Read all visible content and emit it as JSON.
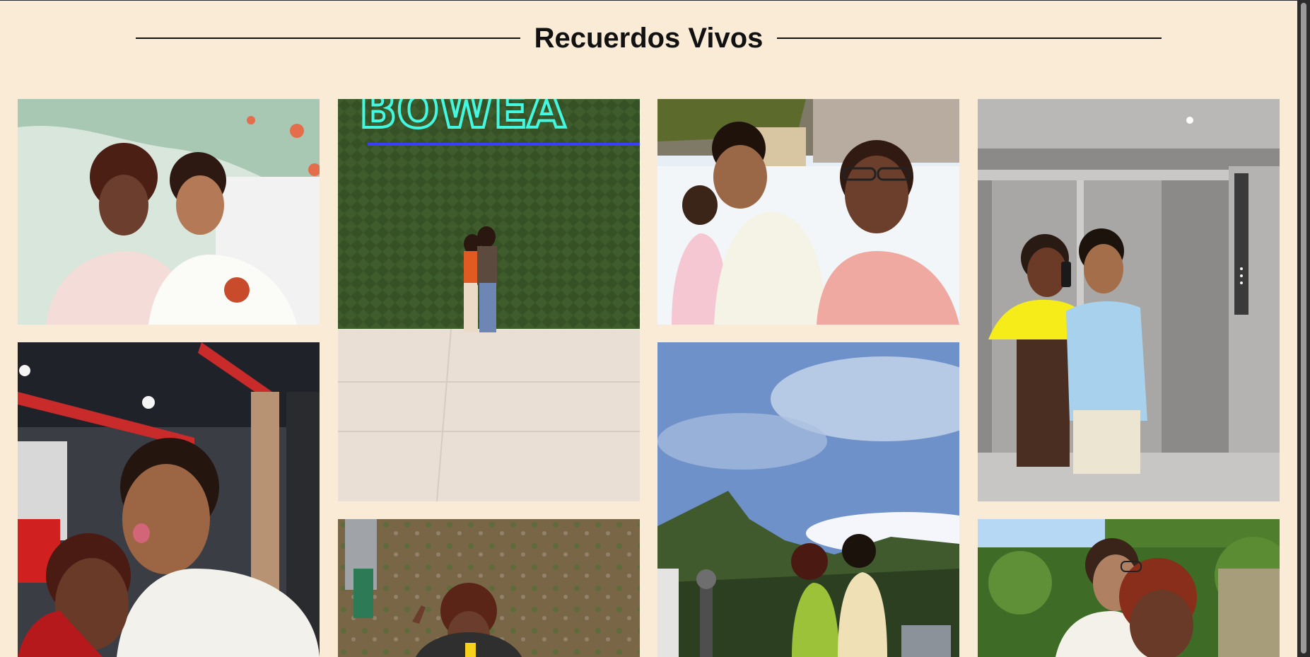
{
  "page": {
    "title": "Recuerdos Vivos"
  },
  "gallery": {
    "photos": [
      {
        "id": "p1",
        "name": "photo-couple-mural-selfie",
        "caption": ""
      },
      {
        "id": "p2",
        "name": "photo-couple-green-wall",
        "caption": ""
      },
      {
        "id": "p3",
        "name": "photo-group-ice-rink",
        "caption": ""
      },
      {
        "id": "p4",
        "name": "photo-elevator-mirror-selfie",
        "caption": ""
      },
      {
        "id": "p5",
        "name": "photo-couple-restaurant-selfie",
        "caption": ""
      },
      {
        "id": "p6",
        "name": "photo-mountain-embrace",
        "caption": ""
      },
      {
        "id": "p7",
        "name": "photo-girl-peace-sign",
        "caption": ""
      },
      {
        "id": "p8",
        "name": "photo-couple-garden-selfie",
        "caption": ""
      }
    ]
  },
  "colors": {
    "background": "#faebd7",
    "text": "#111111"
  }
}
